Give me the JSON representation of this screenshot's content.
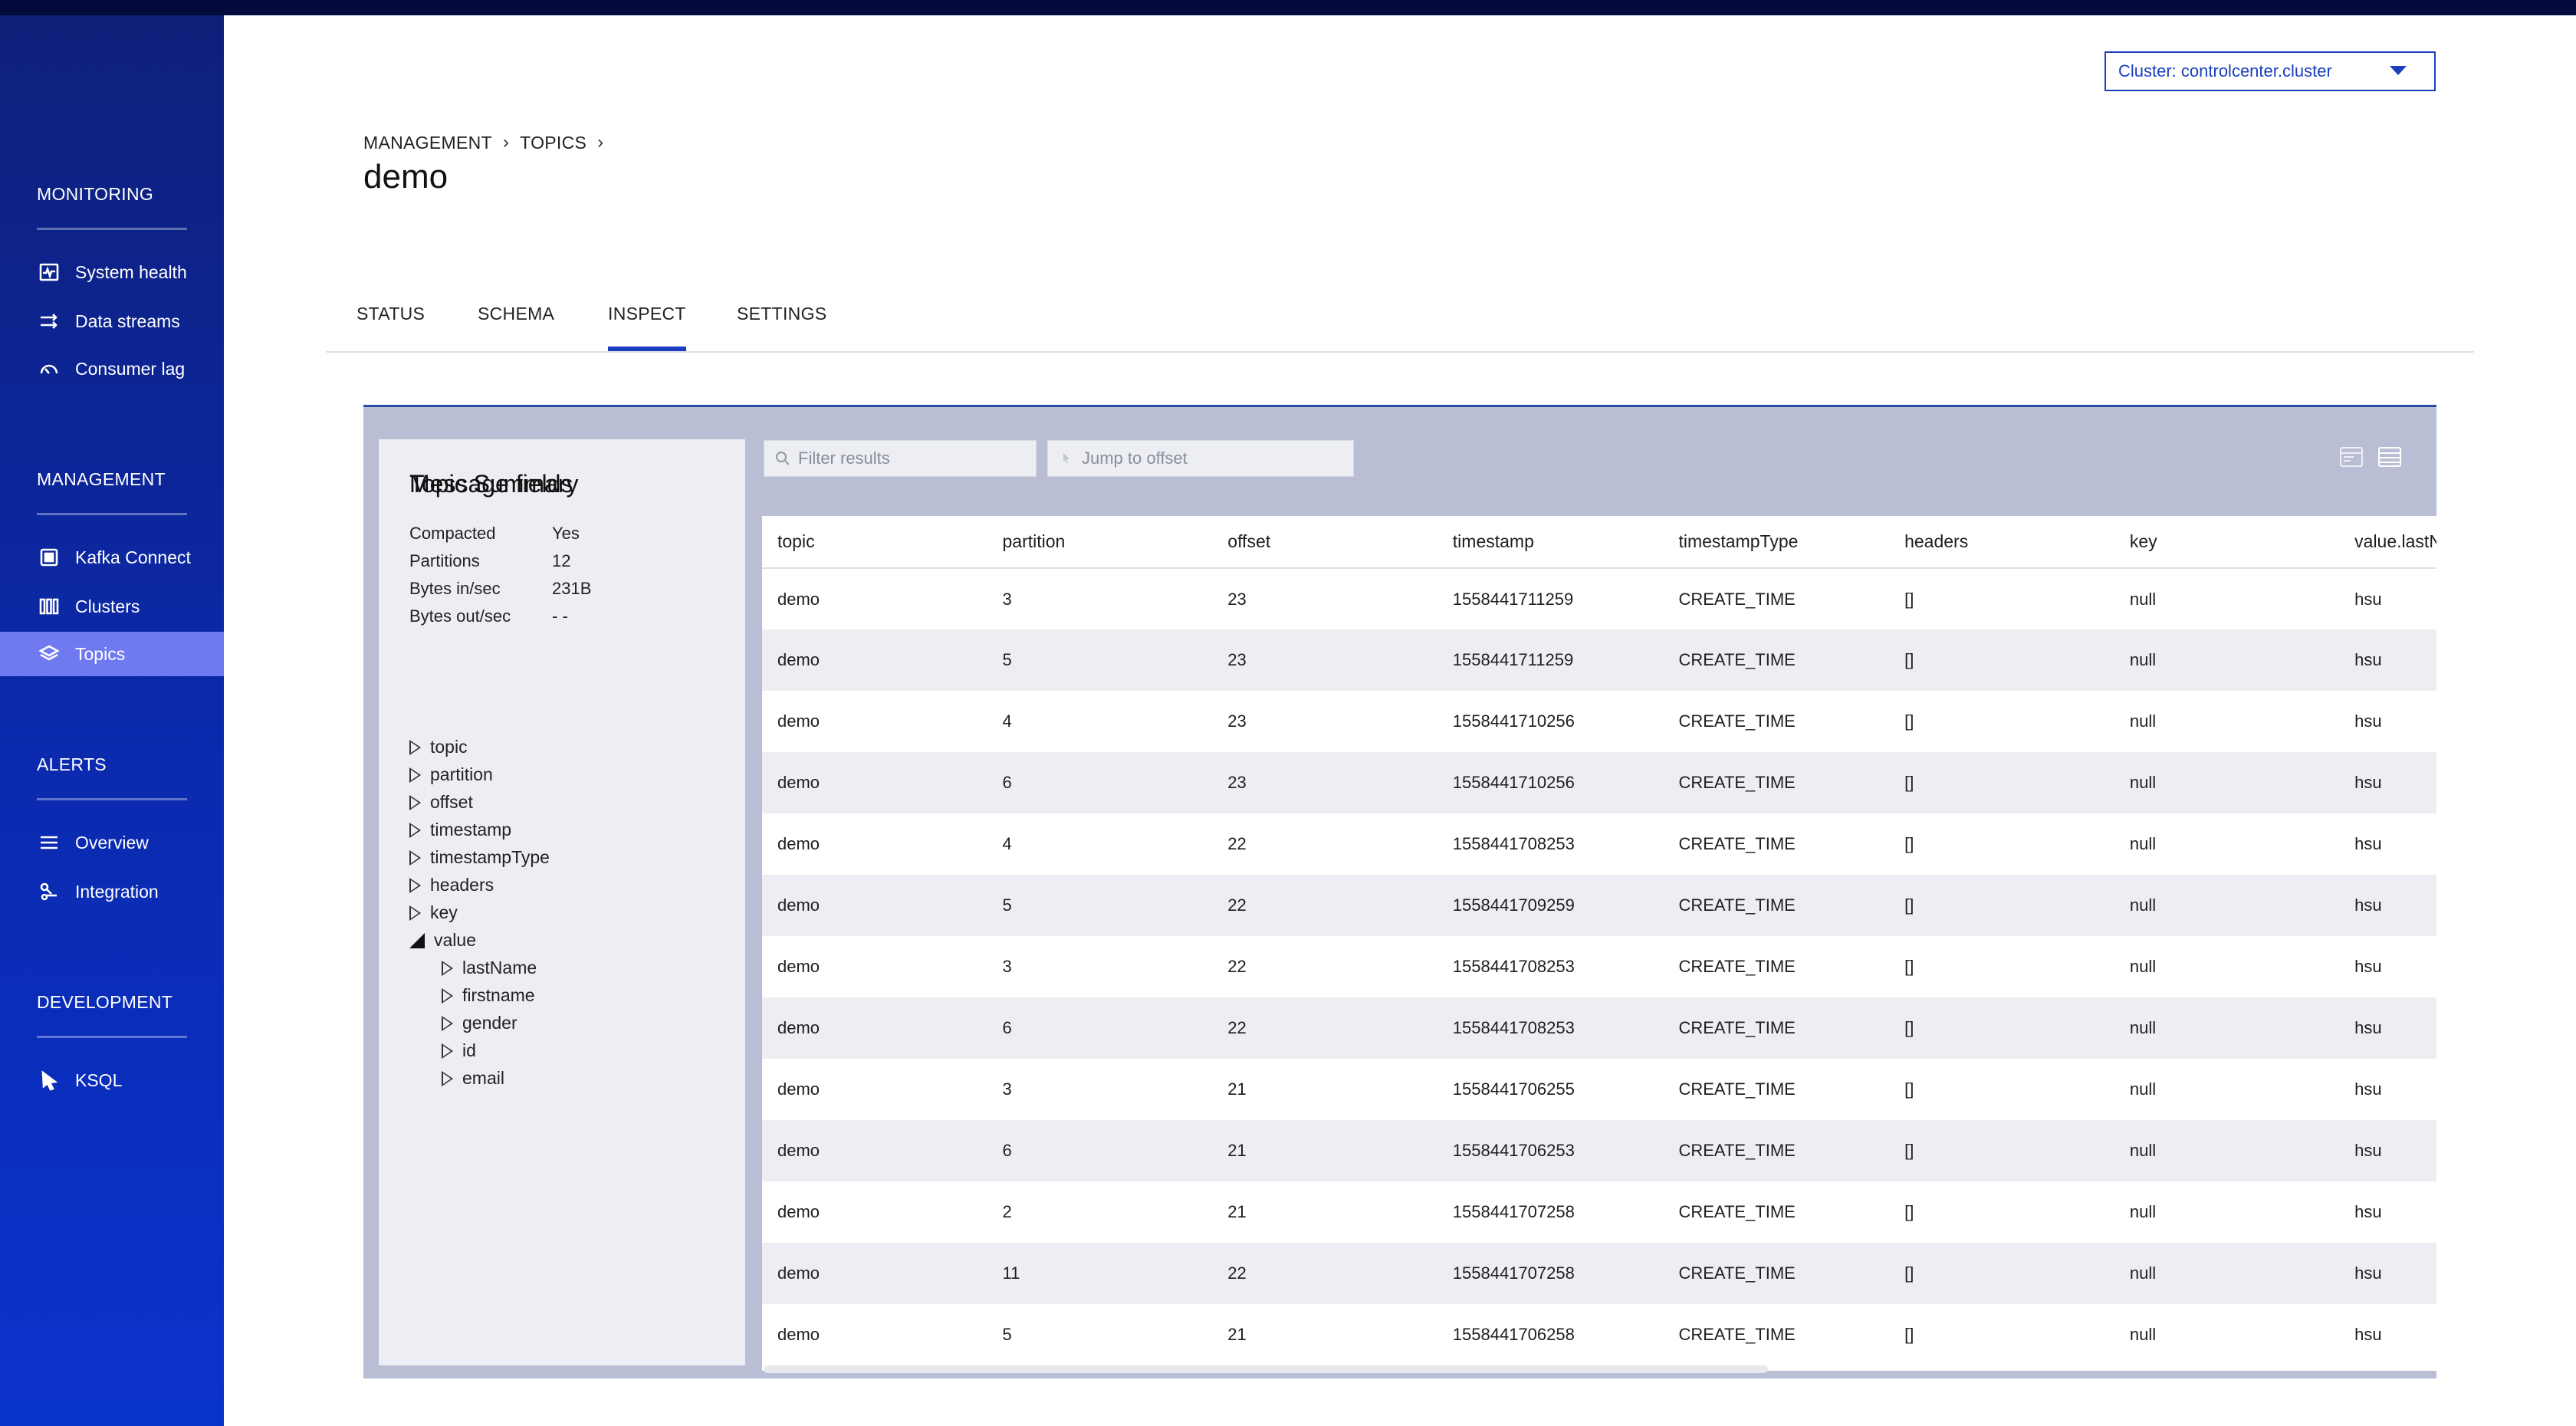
{
  "cluster_select": {
    "value": "Cluster: controlcenter.cluster"
  },
  "sidebar": {
    "sections": [
      {
        "title": "MONITORING",
        "items": [
          {
            "label": "System health",
            "icon": "system-health-icon"
          },
          {
            "label": "Data streams",
            "icon": "data-streams-icon"
          },
          {
            "label": "Consumer lag",
            "icon": "consumer-lag-icon"
          }
        ]
      },
      {
        "title": "MANAGEMENT",
        "items": [
          {
            "label": "Kafka Connect",
            "icon": "kafka-connect-icon"
          },
          {
            "label": "Clusters",
            "icon": "clusters-icon"
          },
          {
            "label": "Topics",
            "icon": "topics-icon",
            "active": true
          }
        ]
      },
      {
        "title": "ALERTS",
        "items": [
          {
            "label": "Overview",
            "icon": "overview-icon"
          },
          {
            "label": "Integration",
            "icon": "integration-icon"
          }
        ]
      },
      {
        "title": "DEVELOPMENT",
        "items": [
          {
            "label": "KSQL",
            "icon": "ksql-icon"
          }
        ]
      }
    ]
  },
  "breadcrumb": {
    "items": [
      "MANAGEMENT",
      "TOPICS"
    ]
  },
  "page_title": "demo",
  "tabs": [
    {
      "label": "STATUS"
    },
    {
      "label": "SCHEMA"
    },
    {
      "label": "INSPECT",
      "active": true
    },
    {
      "label": "SETTINGS"
    }
  ],
  "summary": {
    "title": "Topic Summary",
    "rows": [
      {
        "key": "Compacted",
        "value": "Yes"
      },
      {
        "key": "Partitions",
        "value": "12"
      },
      {
        "key": "Bytes in/sec",
        "value": "231B"
      },
      {
        "key": "Bytes out/sec",
        "value": "- -"
      }
    ],
    "fields_title": "Message fields",
    "fields": [
      {
        "label": "topic",
        "depth": 0
      },
      {
        "label": "partition",
        "depth": 0
      },
      {
        "label": "offset",
        "depth": 0
      },
      {
        "label": "timestamp",
        "depth": 0
      },
      {
        "label": "timestampType",
        "depth": 0
      },
      {
        "label": "headers",
        "depth": 0
      },
      {
        "label": "key",
        "depth": 0
      },
      {
        "label": "value",
        "depth": 0,
        "expanded": true
      },
      {
        "label": "lastName",
        "depth": 1
      },
      {
        "label": "firstname",
        "depth": 1
      },
      {
        "label": "gender",
        "depth": 1
      },
      {
        "label": "id",
        "depth": 1
      },
      {
        "label": "email",
        "depth": 1
      }
    ]
  },
  "toolbar": {
    "filter_placeholder": "Filter results",
    "offset_placeholder": "Jump to offset",
    "view_icons": [
      "card-view-icon",
      "table-view-icon"
    ]
  },
  "table": {
    "columns": [
      "topic",
      "partition",
      "offset",
      "timestamp",
      "timestampType",
      "headers",
      "key",
      "value.lastName"
    ],
    "rows": [
      [
        "demo",
        "3",
        "23",
        "1558441711259",
        "CREATE_TIME",
        "[]",
        "null",
        "hsu"
      ],
      [
        "demo",
        "5",
        "23",
        "1558441711259",
        "CREATE_TIME",
        "[]",
        "null",
        "hsu"
      ],
      [
        "demo",
        "4",
        "23",
        "1558441710256",
        "CREATE_TIME",
        "[]",
        "null",
        "hsu"
      ],
      [
        "demo",
        "6",
        "23",
        "1558441710256",
        "CREATE_TIME",
        "[]",
        "null",
        "hsu"
      ],
      [
        "demo",
        "4",
        "22",
        "1558441708253",
        "CREATE_TIME",
        "[]",
        "null",
        "hsu"
      ],
      [
        "demo",
        "5",
        "22",
        "1558441709259",
        "CREATE_TIME",
        "[]",
        "null",
        "hsu"
      ],
      [
        "demo",
        "3",
        "22",
        "1558441708253",
        "CREATE_TIME",
        "[]",
        "null",
        "hsu"
      ],
      [
        "demo",
        "6",
        "22",
        "1558441708253",
        "CREATE_TIME",
        "[]",
        "null",
        "hsu"
      ],
      [
        "demo",
        "3",
        "21",
        "1558441706255",
        "CREATE_TIME",
        "[]",
        "null",
        "hsu"
      ],
      [
        "demo",
        "6",
        "21",
        "1558441706253",
        "CREATE_TIME",
        "[]",
        "null",
        "hsu"
      ],
      [
        "demo",
        "2",
        "21",
        "1558441707258",
        "CREATE_TIME",
        "[]",
        "null",
        "hsu"
      ],
      [
        "demo",
        "11",
        "22",
        "1558441707258",
        "CREATE_TIME",
        "[]",
        "null",
        "hsu"
      ],
      [
        "demo",
        "5",
        "21",
        "1558441706258",
        "CREATE_TIME",
        "[]",
        "null",
        "hsu"
      ]
    ]
  },
  "colors": {
    "accent": "#1b3fbf",
    "sidebar_active": "#6f79f0",
    "panel_bg": "#b9bed4"
  }
}
